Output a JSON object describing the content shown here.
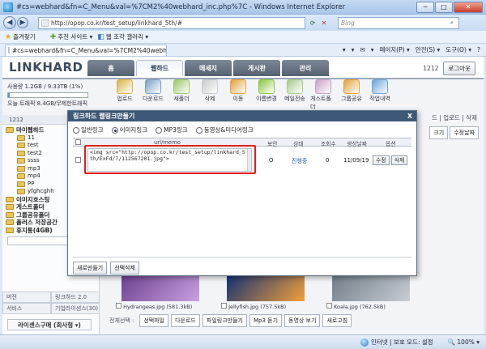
{
  "window": {
    "title": "#cs=webhard&fn=C_Menu&val=%7CM2%40webhard_inc.php%7C - Windows Internet Explorer",
    "minimize": "─",
    "maximize": "□",
    "close": "✕"
  },
  "address": {
    "url": "http://opop.co.kr/test_setup/linkhard_5th/#",
    "search_placeholder": "Bing"
  },
  "favorites": {
    "label": "즐겨찾기",
    "suggested": "추천 사이트 ▾",
    "gallery": "웹 조각 갤러리 ▾"
  },
  "ie_tab": {
    "title": "#cs=webhard&fn=C_Menu&val=%7CM2%40webhard..."
  },
  "ie_tools": [
    "▾",
    "▾",
    "✉",
    "▾",
    "페이지(P) ▾",
    "안전(S) ▾",
    "도구(O) ▾",
    "?"
  ],
  "site": {
    "logo": "LINKHARD",
    "nav": [
      "홈",
      "웹하드",
      "메세지",
      "게시판",
      "관리"
    ],
    "active_nav": 1,
    "user_id": "1212",
    "logout": "로그아웃"
  },
  "usage": {
    "line1": "사용량 1.2GB / 9.33TB (1%)",
    "fill_percent": 1,
    "line2": "오늘 트래픽 8.4GB/무제한트래픽"
  },
  "toolbar": [
    {
      "label": "업로드",
      "color": "#d9b24a",
      "icon": "upload-icon"
    },
    {
      "label": "다운로드",
      "color": "#7d9fc7",
      "icon": "download-icon"
    },
    {
      "label": "새폴더",
      "color": "#9ac76a",
      "icon": "new-folder-icon"
    },
    {
      "label": "삭제",
      "color": "#c9c9c9",
      "icon": "delete-icon"
    },
    {
      "label": "이동",
      "color": "#e0a23e",
      "icon": "move-icon"
    },
    {
      "label": "이름변경",
      "color": "#8cc63f",
      "icon": "rename-icon"
    },
    {
      "label": "메일전송",
      "color": "#a8c98a",
      "icon": "mail-icon"
    }
  ],
  "toolbar_right": [
    {
      "label": "게스트폴더",
      "color": "#c8a0c8",
      "icon": "guest-folder-icon"
    },
    {
      "label": "그룹공유",
      "color": "#e0a23e",
      "icon": "group-share-icon"
    },
    {
      "label": "작업내역",
      "color": "#6aa3d6",
      "icon": "history-icon"
    }
  ],
  "right_labels": "드 | 업로드 | 삭제",
  "list_btns": [
    "크기",
    "수정날짜"
  ],
  "left_panel": {
    "header": "1212",
    "tree": [
      {
        "label": "마이웹하드",
        "level": 0
      },
      {
        "label": "11",
        "level": 1
      },
      {
        "label": "test",
        "level": 1
      },
      {
        "label": "test2",
        "level": 1
      },
      {
        "label": "ssss",
        "level": 1
      },
      {
        "label": "mp3",
        "level": 1
      },
      {
        "label": "mp4",
        "level": 1
      },
      {
        "label": "PP",
        "level": 1
      },
      {
        "label": "yfghcghh",
        "level": 1
      },
      {
        "label": "이미지호스팅",
        "level": 0
      },
      {
        "label": "게스트폴더",
        "level": 0
      },
      {
        "label": "그룹공유폴더",
        "level": 0
      },
      {
        "label": "플러스 저장공간",
        "level": 0
      },
      {
        "label": "휴지통(4GB)",
        "level": 0
      }
    ],
    "bottom_tabs": [
      "버전",
      "링크하드 2.0",
      "서비스",
      "기업라이센스(30)"
    ],
    "promo": "라이센스구매 (회사형 ▾)"
  },
  "thumbs": [
    {
      "name": "Hydrangeas.jpg",
      "size": "(581.3kB)",
      "color1": "#6b3f8e",
      "color2": "#c9a0e0"
    },
    {
      "name": "Jellyfish.jpg",
      "size": "(757.5kB)",
      "color1": "#0f2f74",
      "color2": "#f2a03a"
    },
    {
      "name": "Koala.jpg",
      "size": "(762.5kB)",
      "color1": "#6f7c88",
      "color2": "#c8cdd2"
    }
  ],
  "bottom_bar": [
    "전체선택 :",
    "선택파일",
    "다운로드",
    "파일링크만들기",
    "Mp3 듣기",
    "동영상 보기",
    "새로고침"
  ],
  "modal": {
    "title": "링크하드 웹링크만들기",
    "close": "X",
    "radios": [
      {
        "label": "일반링크",
        "on": false
      },
      {
        "label": "이미지링크",
        "on": true
      },
      {
        "label": "MP3링크",
        "on": false
      },
      {
        "label": "동영상&미디어링크",
        "on": false
      }
    ],
    "headers": {
      "url": "url/memo",
      "security": "보안",
      "status": "상태",
      "views": "조회수",
      "created": "생성날짜",
      "options": "옵션"
    },
    "row": {
      "code": "<img src=\"http://opop.co.kr/test_setup/linkhard_5th/ExFd/7/112567201.jpg\">",
      "security": "O",
      "status": "진행중",
      "views": "0",
      "created": "11/09/19",
      "edit": "수정",
      "delete": "삭제"
    },
    "footer": [
      "새로만들기",
      "선택삭제"
    ]
  },
  "status": {
    "zone": "인터넷 | 보호 모드: 설정",
    "zoom": "🔍 100% ▾"
  }
}
